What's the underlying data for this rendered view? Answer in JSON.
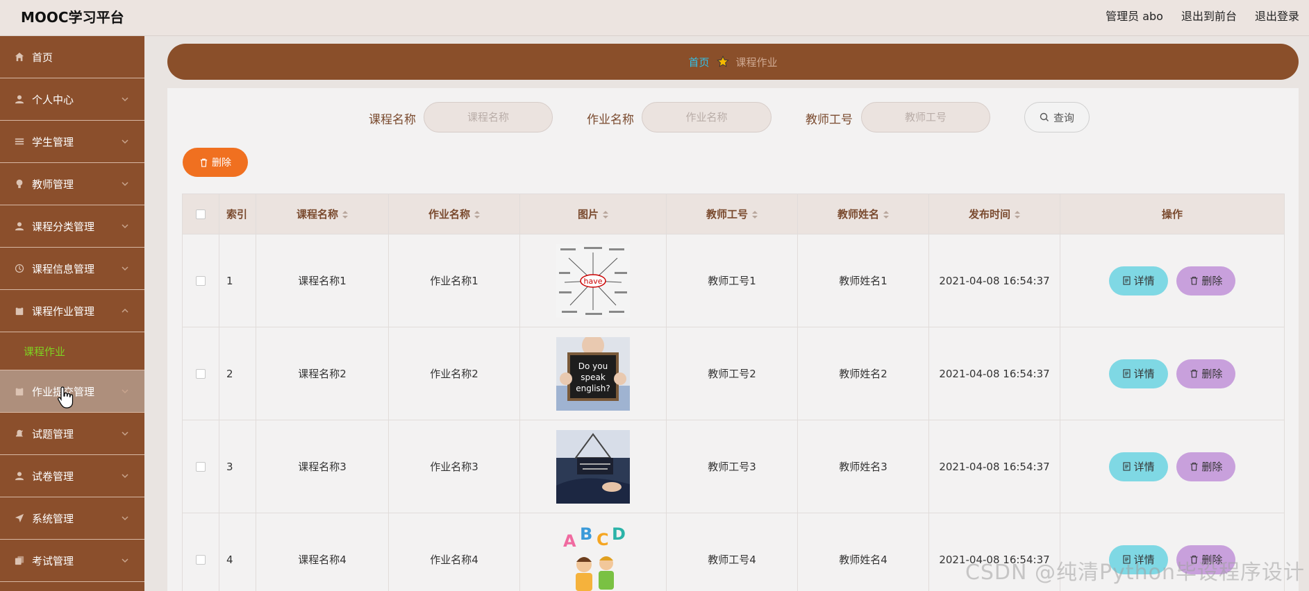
{
  "app": {
    "title": "MOOC学习平台"
  },
  "header": {
    "links": [
      "管理员 abo",
      "退出到前台",
      "退出登录"
    ]
  },
  "sidebar": {
    "items": [
      {
        "label": "首页",
        "icon": "home-icon",
        "expandable": false
      },
      {
        "label": "个人中心",
        "icon": "user-icon",
        "expandable": true
      },
      {
        "label": "学生管理",
        "icon": "list-icon",
        "expandable": true
      },
      {
        "label": "教师管理",
        "icon": "lightbulb-icon",
        "expandable": true
      },
      {
        "label": "课程分类管理",
        "icon": "user-icon",
        "expandable": true
      },
      {
        "label": "课程信息管理",
        "icon": "clock-icon",
        "expandable": true
      },
      {
        "label": "课程作业管理",
        "icon": "clipboard-icon",
        "expandable": true,
        "expanded": true
      },
      {
        "label": "作业提交管理",
        "icon": "clipboard-icon",
        "expandable": true
      },
      {
        "label": "试题管理",
        "icon": "bell-off-icon",
        "expandable": true
      },
      {
        "label": "试卷管理",
        "icon": "user-icon",
        "expandable": true
      },
      {
        "label": "系统管理",
        "icon": "send-icon",
        "expandable": true
      },
      {
        "label": "考试管理",
        "icon": "copy-icon",
        "expandable": true
      }
    ],
    "sub_item": "课程作业"
  },
  "breadcrumb": {
    "home": "首页",
    "current": "课程作业"
  },
  "search": {
    "fields": [
      {
        "label": "课程名称",
        "placeholder": "课程名称"
      },
      {
        "label": "作业名称",
        "placeholder": "作业名称"
      },
      {
        "label": "教师工号",
        "placeholder": "教师工号"
      }
    ],
    "button": "查询"
  },
  "toolbar": {
    "delete_label": "删除"
  },
  "table": {
    "columns": [
      "索引",
      "课程名称",
      "作业名称",
      "图片",
      "教师工号",
      "教师姓名",
      "发布时间",
      "操作"
    ],
    "rows": [
      {
        "index": "1",
        "course": "课程名称1",
        "homework": "作业名称1",
        "teacher_no": "教师工号1",
        "teacher_name": "教师姓名1",
        "time": "2021-04-08 16:54:37"
      },
      {
        "index": "2",
        "course": "课程名称2",
        "homework": "作业名称2",
        "teacher_no": "教师工号2",
        "teacher_name": "教师姓名2",
        "time": "2021-04-08 16:54:37"
      },
      {
        "index": "3",
        "course": "课程名称3",
        "homework": "作业名称3",
        "teacher_no": "教师工号3",
        "teacher_name": "教师姓名3",
        "time": "2021-04-08 16:54:37"
      },
      {
        "index": "4",
        "course": "课程名称4",
        "homework": "作业名称4",
        "teacher_no": "教师工号4",
        "teacher_name": "教师姓名4",
        "time": "2021-04-08 16:54:37"
      }
    ],
    "detail_label": "详情",
    "delete_label": "删除"
  },
  "images": {
    "row1_word": "have",
    "row2_lines": [
      "Do you",
      "speak",
      "english?"
    ],
    "row4_letters": [
      "A",
      "B",
      "C",
      "D"
    ]
  },
  "watermark": "CSDN @纯清Python毕设程序设计",
  "colors": {
    "sidebar": "#8b4f2c",
    "accent_orange": "#f07020",
    "detail": "#7fd8e4",
    "remove": "#c8a0dc",
    "link": "#33c0e8",
    "active_sub": "#7ed321"
  }
}
